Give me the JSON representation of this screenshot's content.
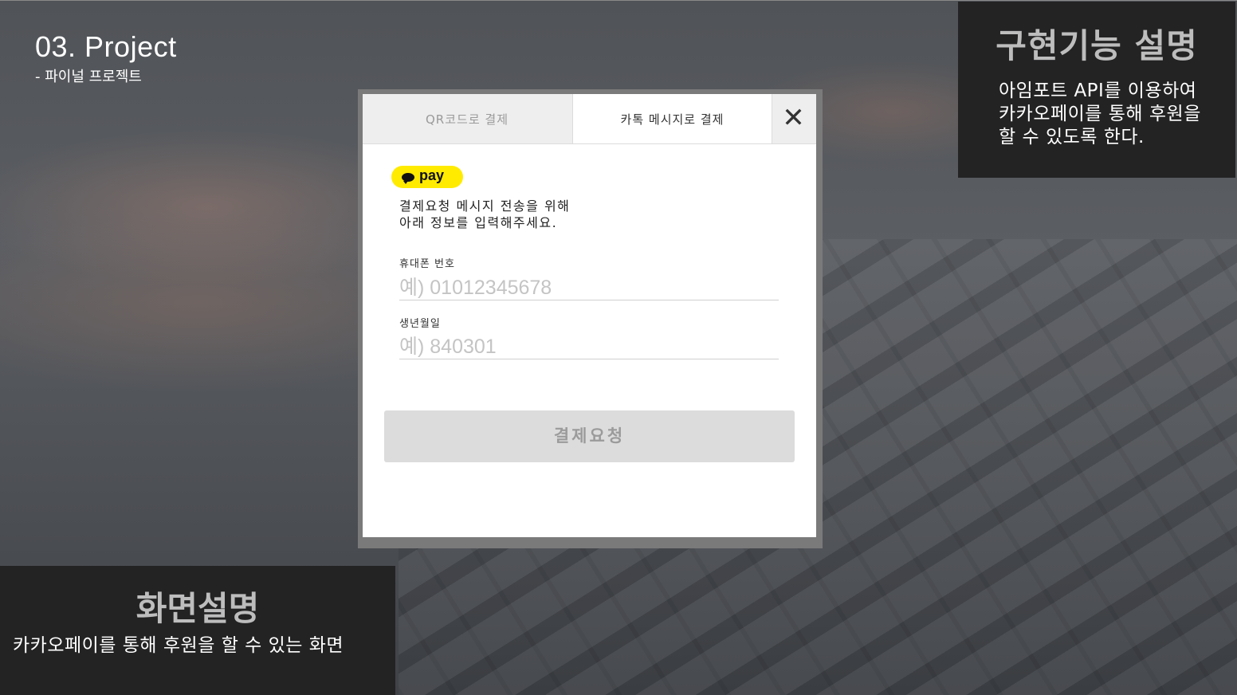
{
  "slide": {
    "title": "03. Project",
    "subtitle": "- 파이널 프로젝트"
  },
  "feature_panel": {
    "heading": "구현기능 설명",
    "description": "아임포트 API를 이용하여 카카오페이를 통해 후원을 할 수 있도록 한다."
  },
  "screen_panel": {
    "heading": "화면설명",
    "description": "카카오페이를 통해 후원을 할 수 있는 화면"
  },
  "payment_modal": {
    "tabs": [
      {
        "label": "QR코드로 결제",
        "active": false
      },
      {
        "label": "카톡 메시지로 결제",
        "active": true
      }
    ],
    "close_icon": "close-icon",
    "brand_badge": "pay",
    "guide_line1": "결제요청 메시지 전송을 위해",
    "guide_line2": "아래 정보를 입력해주세요.",
    "phone_label": "휴대폰 번호",
    "phone_placeholder": "예) 01012345678",
    "birth_label": "생년월일",
    "birth_placeholder": "예) 840301",
    "submit_label": "결제요청"
  },
  "colors": {
    "kakao_yellow": "#ffeb00",
    "panel_bg": "#232324",
    "disabled_button": "#dcdcdc"
  }
}
